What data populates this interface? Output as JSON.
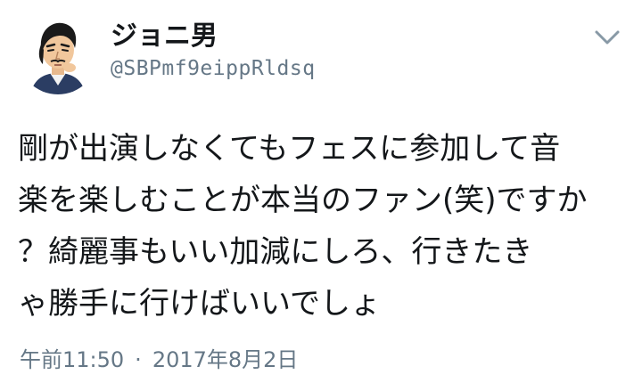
{
  "user": {
    "display_name": "ジョニ男",
    "handle": "@SBPmf9eippRldsq",
    "avatar_icon": "caricature-avatar-icon"
  },
  "menu": {
    "icon": "chevron-down-icon"
  },
  "tweet": {
    "lines": [
      "剛が出演しなくてもフェスに参加して音",
      "楽を楽しむことが本当のファン(笑)ですか？綺麗事もいい加減にしろ、行きたき",
      "や勝手に行けばいいでしょ"
    ],
    "line_1": "剛が出演しなくてもフェスに参加して音",
    "line_2": "楽を楽しむことが本当のファン(笑)ですか",
    "line_3": "？綺麗事もいい加減にしろ、行きたき",
    "line_4": "ゃ勝手に行けばいいでしょ"
  },
  "meta": {
    "time": "午前11:50",
    "separator": "·",
    "date": "2017年8月2日"
  },
  "colors": {
    "text": "#14171a",
    "secondary": "#657786",
    "background": "#ffffff"
  }
}
